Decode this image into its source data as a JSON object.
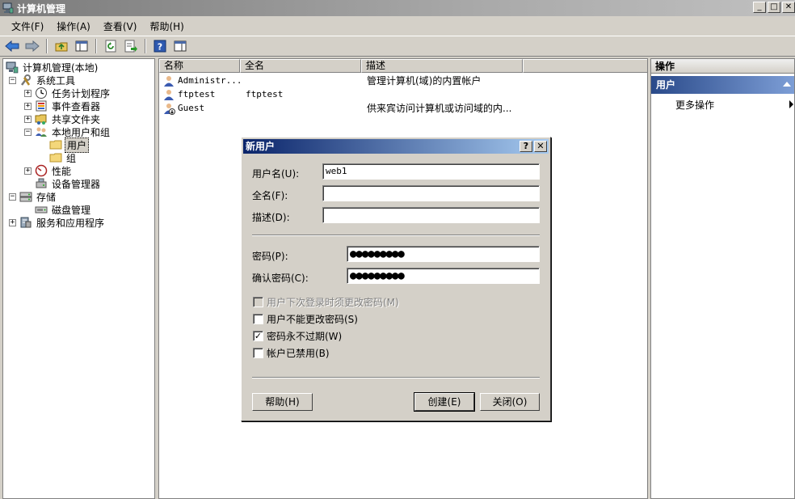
{
  "window": {
    "title": "计算机管理"
  },
  "menu": [
    "文件(F)",
    "操作(A)",
    "查看(V)",
    "帮助(H)"
  ],
  "tree": [
    {
      "label": "计算机管理(本地)",
      "level": 0,
      "expander": ""
    },
    {
      "label": "系统工具",
      "level": 1,
      "expander": "−"
    },
    {
      "label": "任务计划程序",
      "level": 2,
      "expander": "+"
    },
    {
      "label": "事件查看器",
      "level": 2,
      "expander": "+"
    },
    {
      "label": "共享文件夹",
      "level": 2,
      "expander": "+"
    },
    {
      "label": "本地用户和组",
      "level": 2,
      "expander": "−"
    },
    {
      "label": "用户",
      "level": 3,
      "expander": ""
    },
    {
      "label": "组",
      "level": 3,
      "expander": ""
    },
    {
      "label": "性能",
      "level": 2,
      "expander": "+"
    },
    {
      "label": "设备管理器",
      "level": 2,
      "expander": ""
    },
    {
      "label": "存储",
      "level": 1,
      "expander": "−"
    },
    {
      "label": "磁盘管理",
      "level": 2,
      "expander": ""
    },
    {
      "label": "服务和应用程序",
      "level": 1,
      "expander": "+"
    }
  ],
  "list": {
    "columns": [
      "名称",
      "全名",
      "描述"
    ],
    "rows": [
      {
        "name": "Administr...",
        "fullname": "",
        "desc": "管理计算机(域)的内置帐户"
      },
      {
        "name": "ftptest",
        "fullname": "ftptest",
        "desc": ""
      },
      {
        "name": "Guest",
        "fullname": "",
        "desc": "供来宾访问计算机或访问域的内..."
      }
    ]
  },
  "actions": {
    "title": "操作",
    "group": "用户",
    "more": "更多操作"
  },
  "dialog": {
    "title": "新用户",
    "help_glyph": "?",
    "close_glyph": "✕",
    "username_label": "用户名(U):",
    "username_value": "web1",
    "fullname_label": "全名(F):",
    "fullname_value": "",
    "desc_label": "描述(D):",
    "desc_value": "",
    "password_label": "密码(P):",
    "password_mask": "●●●●●●●●●",
    "confirm_label": "确认密码(C):",
    "confirm_mask": "●●●●●●●●●",
    "checkboxes": [
      {
        "label": "用户下次登录时须更改密码(M)",
        "checked": false,
        "disabled": true
      },
      {
        "label": "用户不能更改密码(S)",
        "checked": false,
        "disabled": false
      },
      {
        "label": "密码永不过期(W)",
        "checked": true,
        "disabled": false
      },
      {
        "label": "帐户已禁用(B)",
        "checked": false,
        "disabled": false
      }
    ],
    "check_glyph": "✓",
    "help_button": "帮助(H)",
    "create_button": "创建(E)",
    "close_button": "关闭(O)"
  }
}
